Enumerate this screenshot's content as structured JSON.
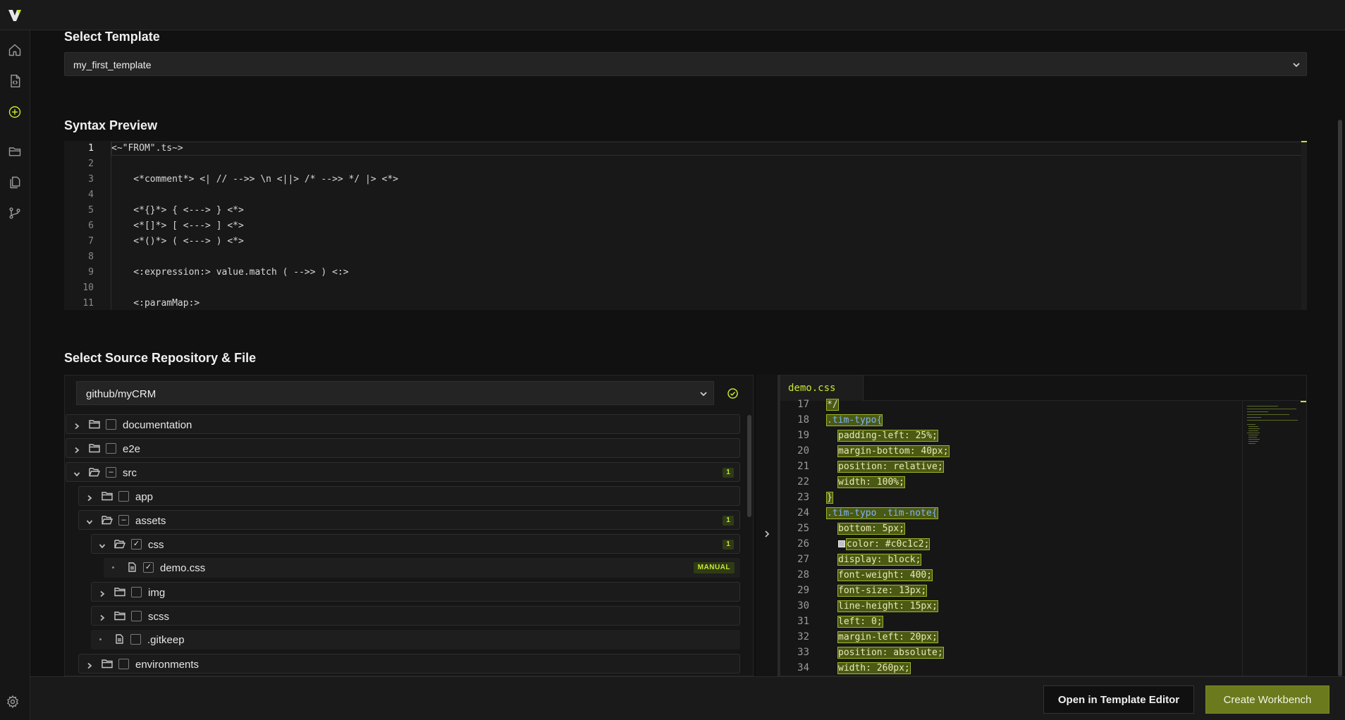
{
  "colors": {
    "accent": "#c8e62f",
    "background": "#111111",
    "panel": "#181818",
    "primary_button": "#6b7a1d"
  },
  "sidebar": {
    "icons": [
      "home-icon",
      "code-file-icon",
      "add-circle-icon",
      "folder-icon",
      "files-icon",
      "git-branch-icon"
    ],
    "settings_icon": "gear-icon"
  },
  "template_section": {
    "title": "Select Template",
    "selected": "my_first_template"
  },
  "syntax_section": {
    "title": "Syntax Preview",
    "line_numbers": [
      "1",
      "2",
      "3",
      "4",
      "5",
      "6",
      "7",
      "8",
      "9",
      "10",
      "11"
    ],
    "lines": [
      "<~\"FROM\".ts~>",
      "",
      "    <*comment*> <| // -->> \\n <||> /* -->> */ |> <*>",
      "",
      "    <*{}*> { <---> } <*>",
      "    <*[]*> [ <---> ] <*>",
      "    <*()*> ( <---> ) <*>",
      "",
      "    <:expression:> value.match ( -->> ) <:>",
      "",
      "    <:paramMap:>"
    ]
  },
  "repo_section": {
    "title": "Select Source Repository & File",
    "repository": "github/myCRM",
    "tree": [
      {
        "name": "documentation",
        "check": "",
        "count": ""
      },
      {
        "name": "e2e",
        "check": "",
        "count": ""
      },
      {
        "name": "src",
        "check": "–",
        "count": "1"
      },
      {
        "name": "app",
        "check": "",
        "count": ""
      },
      {
        "name": "assets",
        "check": "–",
        "count": "1"
      },
      {
        "name": "css",
        "check": "✓",
        "count": "1"
      },
      {
        "name": "demo.css",
        "check": "✓",
        "badge": "MANUAL"
      },
      {
        "name": "img",
        "check": "",
        "count": ""
      },
      {
        "name": "scss",
        "check": "",
        "count": ""
      },
      {
        "name": ".gitkeep",
        "check": ""
      },
      {
        "name": "environments",
        "check": "",
        "count": ""
      }
    ]
  },
  "editor": {
    "tab": "demo.css",
    "line_numbers": [
      "17",
      "18",
      "19",
      "20",
      "21",
      "22",
      "23",
      "24",
      "25",
      "26",
      "27",
      "28",
      "29",
      "30",
      "31",
      "32",
      "33",
      "34"
    ],
    "lines": [
      "*/",
      ".tim-typo{",
      "padding-left: 25%;",
      "margin-bottom: 40px;",
      "position: relative;",
      "width: 100%;",
      "}",
      ".tim-typo .tim-note{",
      "bottom: 5px;",
      "color: #c0c1c2;",
      "display: block;",
      "font-weight: 400;",
      "font-size: 13px;",
      "line-height: 15px;",
      "left: 0;",
      "margin-left: 20px;",
      "position: absolute;",
      "width: 260px;"
    ]
  },
  "footer": {
    "secondary_button": "Open in Template Editor",
    "primary_button": "Create Workbench"
  }
}
